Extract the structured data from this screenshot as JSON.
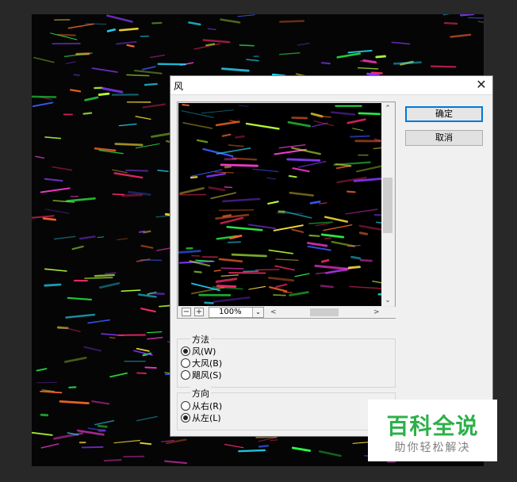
{
  "dialog": {
    "title": "风",
    "close_glyph": "✕",
    "ok_label": "确定",
    "cancel_label": "取消",
    "preview": {
      "zoom_out_glyph": "−",
      "zoom_in_glyph": "+",
      "zoom_value": "100%",
      "dropdown_glyph": "⌄",
      "scroll_up_glyph": "⌃",
      "scroll_down_glyph": "⌄",
      "scroll_left_glyph": "<",
      "scroll_right_glyph": ">"
    },
    "method": {
      "label": "方法",
      "options": [
        {
          "label": "风(W)",
          "selected": true
        },
        {
          "label": "大风(B)",
          "selected": false
        },
        {
          "label": "飓风(S)",
          "selected": false
        }
      ]
    },
    "direction": {
      "label": "方向",
      "options": [
        {
          "label": "从右(R)",
          "selected": false
        },
        {
          "label": "从左(L)",
          "selected": true
        }
      ]
    }
  },
  "watermark": {
    "title": "百科全说",
    "subtitle": "助你轻松解决",
    "color": "#2db04a"
  }
}
